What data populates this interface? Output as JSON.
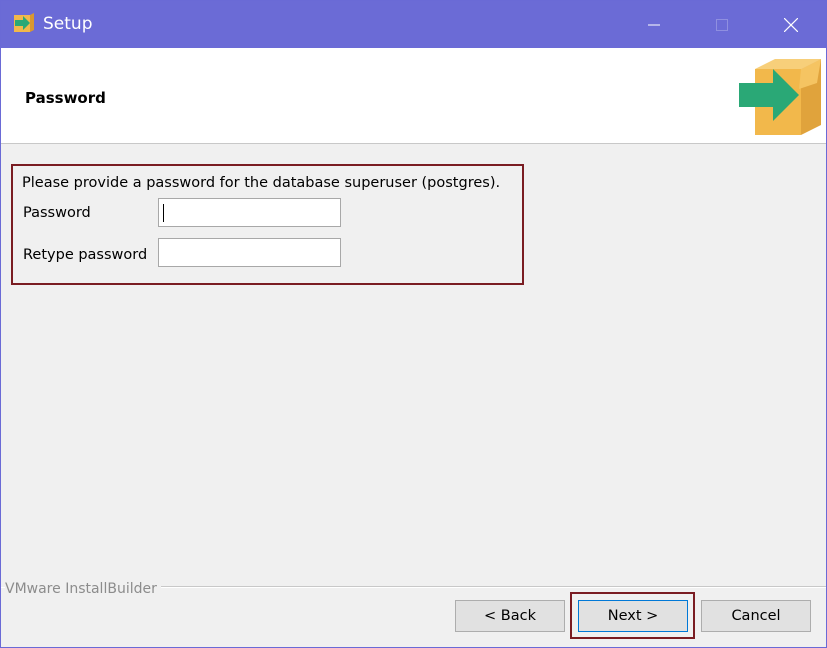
{
  "window": {
    "title": "Setup",
    "icon": "installer-arrow-icon",
    "controls": [
      "minimize-icon",
      "maximize-icon",
      "close-icon"
    ]
  },
  "header": {
    "title": "Password",
    "logo": "box-arrow-logo-icon"
  },
  "form": {
    "description": "Please provide a password for the database superuser (postgres).",
    "password_label": "Password",
    "password_value": "",
    "retype_label": "Retype password",
    "retype_value": ""
  },
  "footer": {
    "brand": "VMware InstallBuilder",
    "back_label": "< Back",
    "next_label": "Next >",
    "cancel_label": "Cancel"
  },
  "colors": {
    "titlebar": "#6b6bd6",
    "highlight_border": "#7a1c22",
    "accent_green": "#2aa876",
    "box_orange": "#f2b84b"
  }
}
